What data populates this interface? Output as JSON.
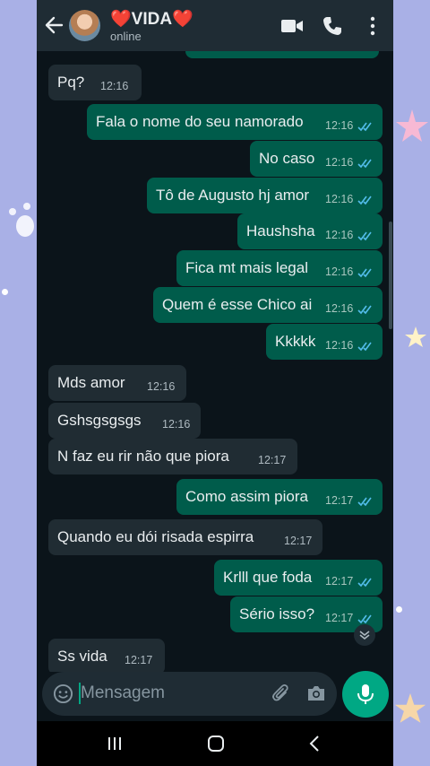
{
  "header": {
    "contact_name": "❤️VIDA❤️",
    "status": "online"
  },
  "input": {
    "placeholder": "Mensagem"
  },
  "messages": [
    {
      "text": "Pq?",
      "time": "12:16",
      "dir": "in"
    },
    {
      "text": "Fala o nome do seu namorado",
      "time": "12:16",
      "dir": "out"
    },
    {
      "text": "No caso",
      "time": "12:16",
      "dir": "out"
    },
    {
      "text": "Tô de Augusto hj amor",
      "time": "12:16",
      "dir": "out"
    },
    {
      "text": "Haushsha",
      "time": "12:16",
      "dir": "out"
    },
    {
      "text": "Fica mt mais legal",
      "time": "12:16",
      "dir": "out"
    },
    {
      "text": "Quem é esse Chico ai",
      "time": "12:16",
      "dir": "out"
    },
    {
      "text": "Kkkkk",
      "time": "12:16",
      "dir": "out"
    },
    {
      "text": "Mds amor",
      "time": "12:16",
      "dir": "in"
    },
    {
      "text": "Gshsgsgsgs",
      "time": "12:16",
      "dir": "in"
    },
    {
      "text": "N faz eu rir não que piora",
      "time": "12:17",
      "dir": "in"
    },
    {
      "text": "Como assim piora",
      "time": "12:17",
      "dir": "out"
    },
    {
      "text": "Quando eu dói risada espirra",
      "time": "12:17",
      "dir": "in"
    },
    {
      "text": "Krlll que foda",
      "time": "12:17",
      "dir": "out"
    },
    {
      "text": "Sério isso?",
      "time": "12:17",
      "dir": "out"
    },
    {
      "text": "Ss vida",
      "time": "12:17",
      "dir": "in"
    }
  ],
  "colors": {
    "header_bg": "#1f2c34",
    "chat_bg": "#0b141a",
    "incoming_bubble": "#202c33",
    "outgoing_bubble": "#005c4b",
    "accent": "#00a884",
    "read_ticks": "#53bdeb"
  },
  "icons": [
    "back-arrow-icon",
    "video-call-icon",
    "phone-call-icon",
    "more-options-icon",
    "emoji-icon",
    "attach-icon",
    "camera-icon",
    "mic-icon",
    "scroll-down-icon",
    "nav-recents-icon",
    "nav-home-icon",
    "nav-back-icon"
  ]
}
